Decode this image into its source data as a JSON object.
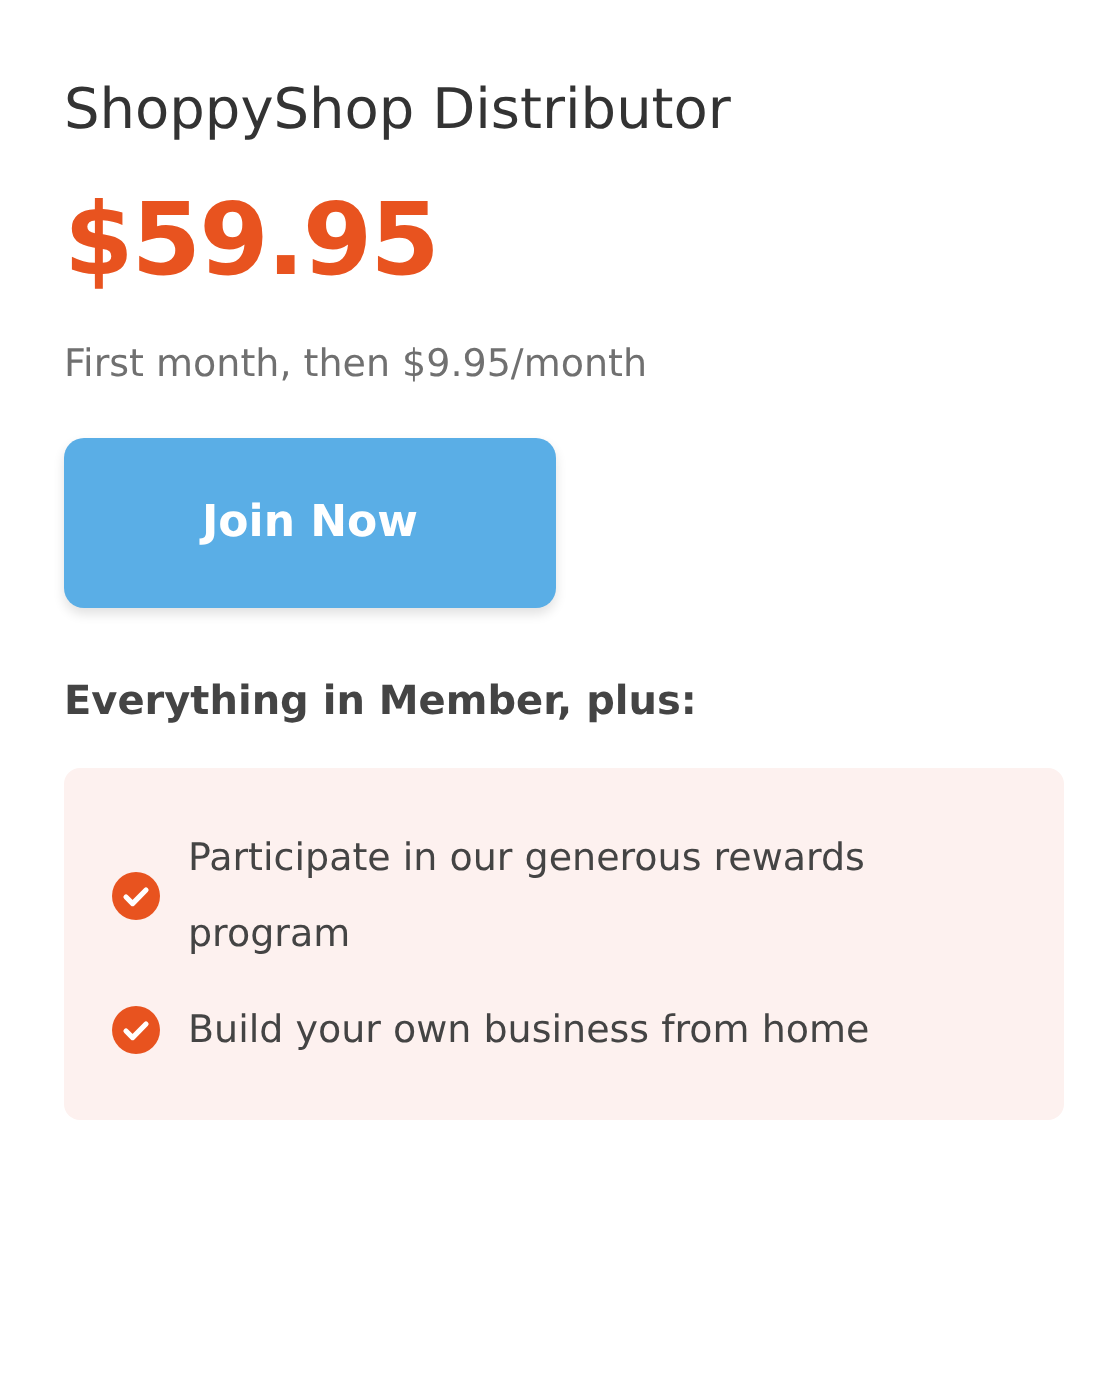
{
  "plan": {
    "title": "ShoppyShop Distributor",
    "price": "$59.95",
    "billing_note": "First month, then $9.95/month",
    "button": "Join Now",
    "features_heading": "Everything in Member, plus:",
    "features": [
      "Participate in our generous rewards program",
      "Build your own business from home"
    ]
  }
}
